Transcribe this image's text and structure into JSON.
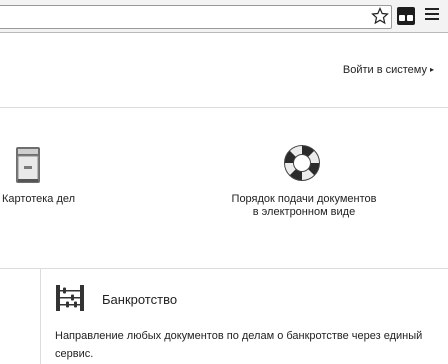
{
  "header": {
    "login_label": "Войти в систему"
  },
  "tiles": [
    {
      "label": "Картотека дел"
    },
    {
      "label": "Порядок подачи документов в электронном виде"
    }
  ],
  "section": {
    "title": "Банкротство",
    "description": "Направление любых документов по делам о банкротстве через единый сервис."
  }
}
